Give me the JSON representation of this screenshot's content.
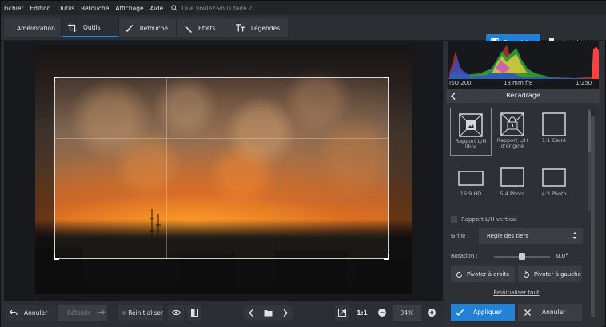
{
  "menu": {
    "items": [
      "Fichier",
      "Edition",
      "Outils",
      "Retouche",
      "Affichage",
      "Aide"
    ],
    "search_placeholder": "Que voulez-vous faire ?"
  },
  "tabs": [
    {
      "label": "Amélioration",
      "icon": "sliders-icon"
    },
    {
      "label": "Outils",
      "icon": "crop-icon",
      "active": true
    },
    {
      "label": "Retouche",
      "icon": "brush-icon"
    },
    {
      "label": "Effets",
      "icon": "magic-wand-icon"
    },
    {
      "label": "Légendes",
      "icon": "text-icon"
    }
  ],
  "actions": {
    "save": "Enregistrer",
    "print": "Imprimer"
  },
  "histogram": {
    "iso": "ISO 200",
    "lens": "18 mm f/8",
    "shutter": "1/250"
  },
  "panel": {
    "title": "Recadrage",
    "ratios": [
      {
        "label": "Rapport L/H libre",
        "icon": "free-ratio-icon",
        "selected": true
      },
      {
        "label": "Rapport L/H d'origine",
        "icon": "original-ratio-icon"
      },
      {
        "label": "1:1 Carré",
        "icon": "square-ratio-icon"
      },
      {
        "label": "16:9 HD",
        "icon": "ratio-16-9-icon"
      },
      {
        "label": "5:4 Photo",
        "icon": "ratio-5-4-icon"
      },
      {
        "label": "4:3 Photo",
        "icon": "ratio-4-3-icon"
      }
    ],
    "vertical_ratio_label": "Rapport L/H vertical",
    "grid_label": "Grille :",
    "grid_value": "Règle des tiers",
    "rotation_label": "Rotation :",
    "rotation_value": "0,0°",
    "rotation_fraction": 0.5,
    "pivot_right": "Pivoter à droite",
    "pivot_left": "Pivoter à gauche",
    "reset_all": "Réinitialiser tout",
    "apply": "Appliquer",
    "cancel": "Annuler"
  },
  "bottombar": {
    "undo": "Annuler",
    "redo": "Rétablir",
    "reset": "Réinitialiser",
    "one_to_one": "1:1",
    "zoom": "94%"
  },
  "colors": {
    "accent": "#2181d6",
    "panel": "#2d3035",
    "background": "#2b2e33"
  }
}
